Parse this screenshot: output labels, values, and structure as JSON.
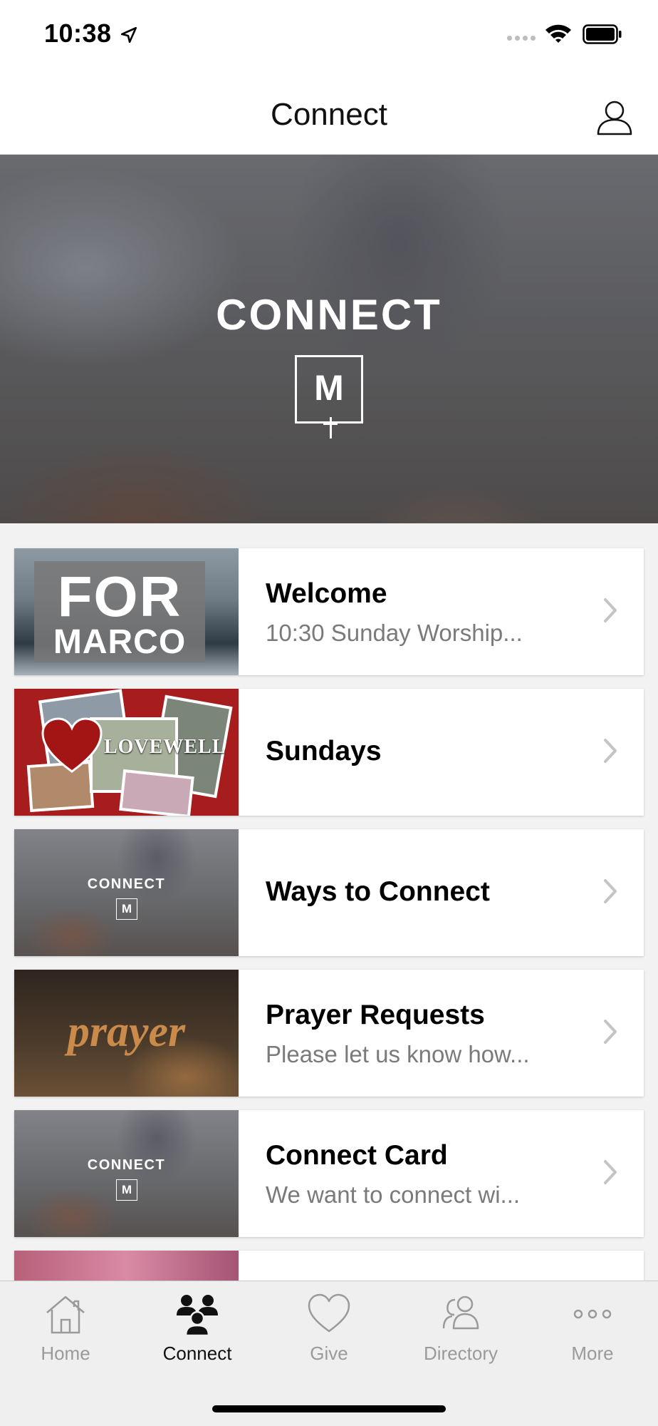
{
  "status_bar": {
    "time": "10:38"
  },
  "nav": {
    "title": "Connect"
  },
  "hero": {
    "title": "CONNECT",
    "logo_letter": "M"
  },
  "items": [
    {
      "title": "Welcome",
      "subtitle": "10:30 Sunday Worship...",
      "thumb": {
        "line1": "FOR",
        "line2": "MARCO"
      }
    },
    {
      "title": "Sundays",
      "subtitle": "",
      "thumb": {
        "text": "LOVEWELL"
      }
    },
    {
      "title": "Ways to Connect",
      "subtitle": "",
      "thumb": {
        "title": "CONNECT",
        "logo": "M"
      }
    },
    {
      "title": "Prayer Requests",
      "subtitle": "Please let us know how...",
      "thumb": {
        "text": "prayer"
      }
    },
    {
      "title": "Connect Card",
      "subtitle": "We want to connect wi...",
      "thumb": {
        "title": "CONNECT",
        "logo": "M"
      }
    }
  ],
  "tabs": [
    {
      "label": "Home",
      "icon": "house-icon",
      "active": false
    },
    {
      "label": "Connect",
      "icon": "people-icon",
      "active": true
    },
    {
      "label": "Give",
      "icon": "heart-icon",
      "active": false
    },
    {
      "label": "Directory",
      "icon": "contacts-icon",
      "active": false
    },
    {
      "label": "More",
      "icon": "more-icon",
      "active": false
    }
  ],
  "colors": {
    "active_tab": "#111111",
    "inactive_tab": "#9a9a9a",
    "subtitle": "#7a7a7a"
  }
}
